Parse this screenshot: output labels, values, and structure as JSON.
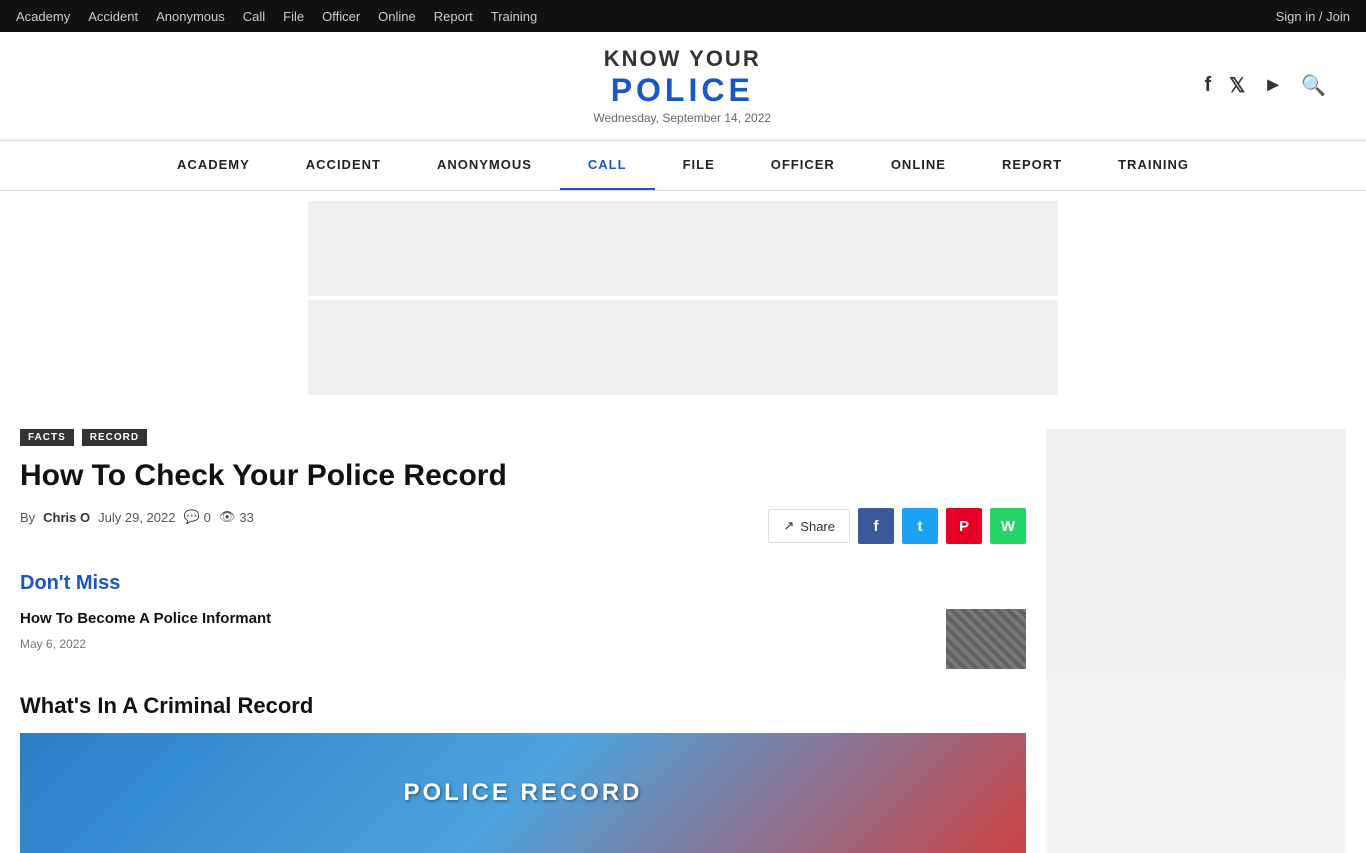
{
  "topbar": {
    "links": [
      "Academy",
      "Accident",
      "Anonymous",
      "Call",
      "File",
      "Officer",
      "Online",
      "Report",
      "Training"
    ],
    "signin": "Sign in / Join"
  },
  "header": {
    "logo_know": "KNOW YOUR",
    "logo_police": "POLICE",
    "date": "Wednesday, September 14, 2022",
    "icons": [
      "f",
      "𝕏",
      "▶",
      "🔍"
    ]
  },
  "mainnav": {
    "items": [
      "ACADEMY",
      "ACCIDENT",
      "ANONYMOUS",
      "CALL",
      "FILE",
      "OFFICER",
      "ONLINE",
      "REPORT",
      "TRAINING"
    ]
  },
  "article": {
    "tags": [
      "FACTS",
      "RECORD"
    ],
    "title": "How To Check Your Police Record",
    "by": "By",
    "author": "Chris O",
    "date": "July 29, 2022",
    "comments": "0",
    "views": "33",
    "share_label": "Share",
    "section_title": "What's In A Criminal Record",
    "image_text": "POLICE RECORD"
  },
  "dont_miss": {
    "title": "Don't Miss",
    "items": [
      {
        "title": "How To Become A Police Informant",
        "date": "May 6, 2022"
      }
    ]
  },
  "social": {
    "facebook": "f",
    "twitter": "t",
    "pinterest": "P",
    "whatsapp": "W"
  }
}
